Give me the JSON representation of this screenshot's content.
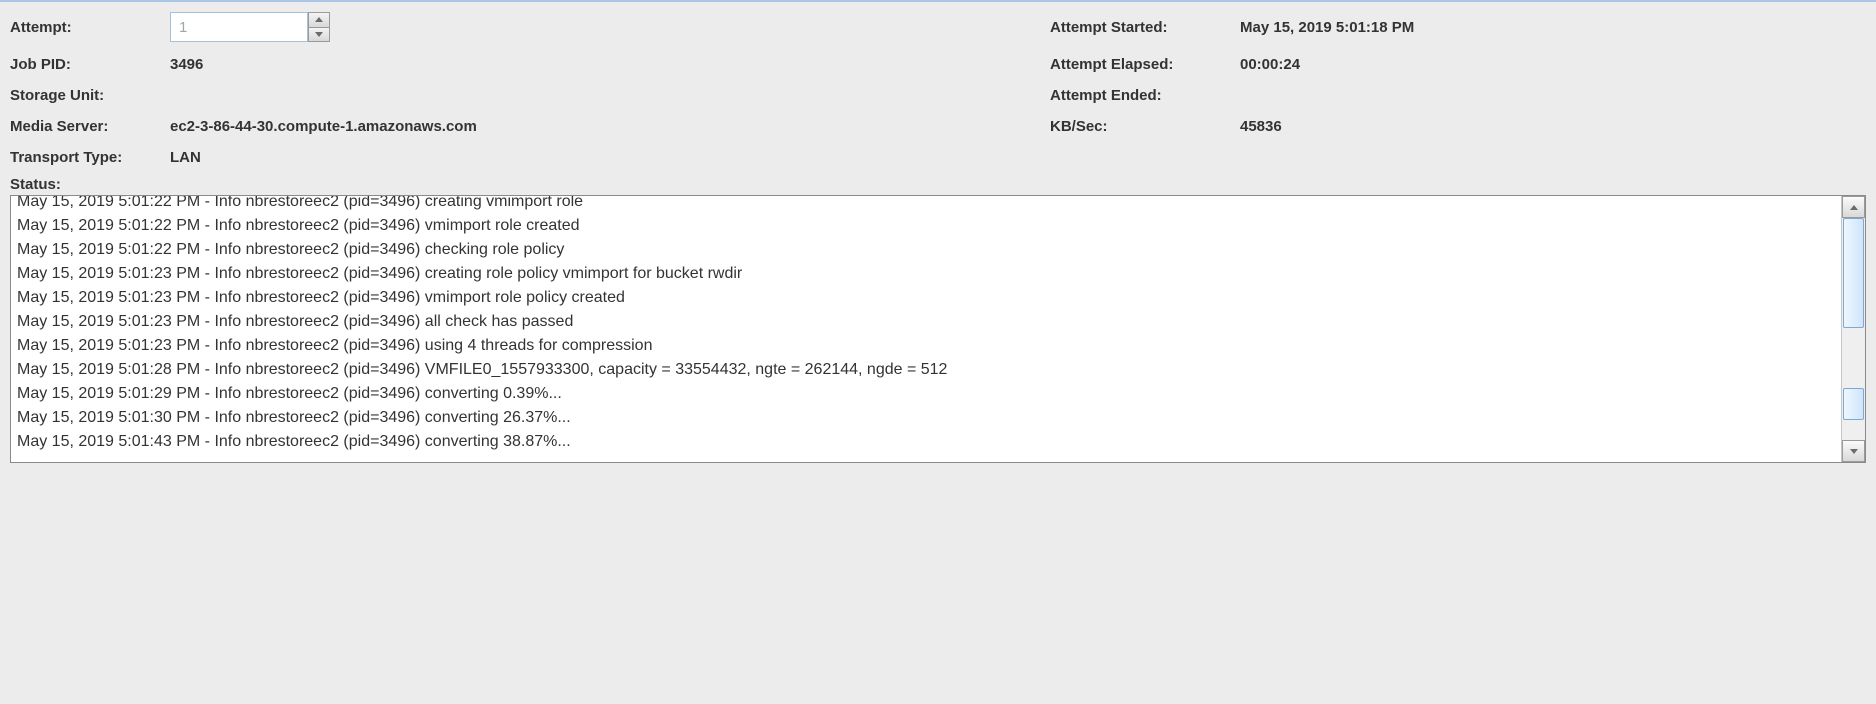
{
  "fields": {
    "attempt_label": "Attempt:",
    "attempt_value": "1",
    "jobpid_label": "Job PID:",
    "jobpid_value": "3496",
    "storageunit_label": "Storage Unit:",
    "storageunit_value": "",
    "mediaserver_label": "Media Server:",
    "mediaserver_value": "ec2-3-86-44-30.compute-1.amazonaws.com",
    "transport_label": "Transport Type:",
    "transport_value": "LAN",
    "attempt_started_label": "Attempt Started:",
    "attempt_started_value": "May 15, 2019 5:01:18 PM",
    "attempt_elapsed_label": "Attempt Elapsed:",
    "attempt_elapsed_value": "00:00:24",
    "attempt_ended_label": "Attempt Ended:",
    "attempt_ended_value": "",
    "kbsec_label": "KB/Sec:",
    "kbsec_value": "45836",
    "status_label": "Status:"
  },
  "log": [
    "May 15, 2019 5:01:22 PM - Info nbrestoreec2 (pid=3496) creating vmimport role",
    "May 15, 2019 5:01:22 PM - Info nbrestoreec2 (pid=3496) vmimport role created",
    "May 15, 2019 5:01:22 PM - Info nbrestoreec2 (pid=3496) checking role policy",
    "May 15, 2019 5:01:23 PM - Info nbrestoreec2 (pid=3496) creating role policy vmimport for bucket rwdir",
    "May 15, 2019 5:01:23 PM - Info nbrestoreec2 (pid=3496) vmimport role policy created",
    "May 15, 2019 5:01:23 PM - Info nbrestoreec2 (pid=3496) all check has passed",
    "May 15, 2019 5:01:23 PM - Info nbrestoreec2 (pid=3496) using 4 threads for compression",
    "May 15, 2019 5:01:28 PM - Info nbrestoreec2 (pid=3496) VMFILE0_1557933300, capacity = 33554432, ngte = 262144, ngde = 512",
    "May 15, 2019 5:01:29 PM - Info nbrestoreec2 (pid=3496) converting 0.39%...",
    "May 15, 2019 5:01:30 PM - Info nbrestoreec2 (pid=3496) converting 26.37%...",
    "May 15, 2019 5:01:43 PM - Info nbrestoreec2 (pid=3496) converting 38.87%..."
  ]
}
